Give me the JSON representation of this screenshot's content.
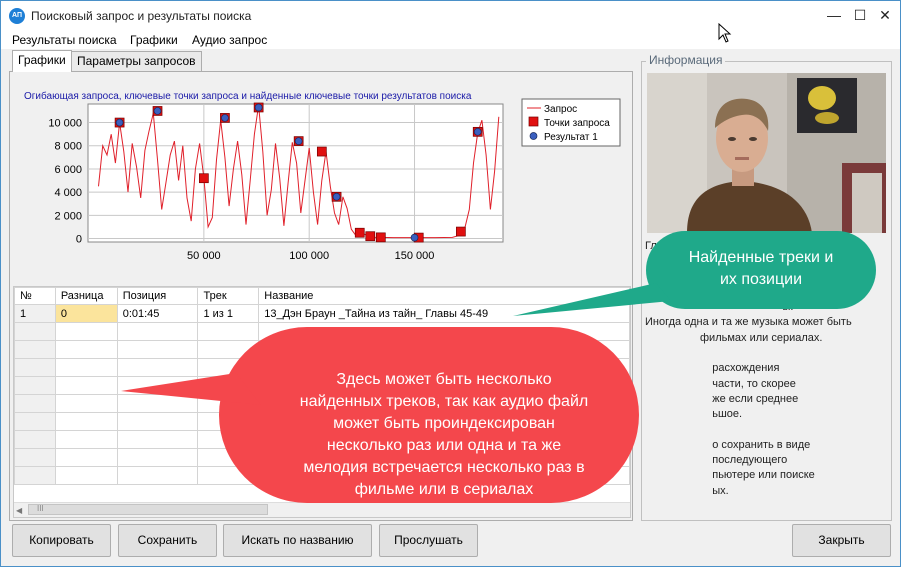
{
  "window": {
    "title": "Поисковый запрос и результаты поиска",
    "app_icon_text": "АП",
    "controls": {
      "minimize": "—",
      "maximize": "☐",
      "close": "✕"
    }
  },
  "menu": [
    "Результаты поиска",
    "Графики",
    "Аудио запрос"
  ],
  "tabs": [
    "Графики",
    "Параметры запросов"
  ],
  "chart_data": {
    "type": "line",
    "title": "Огибающая запроса, ключевые точки запроса и найденные ключевые точки результатов поиска",
    "xlim": [
      -5000,
      192000
    ],
    "ylim": [
      -300,
      11600
    ],
    "x_ticks": [
      50000,
      100000,
      150000
    ],
    "x_tick_labels": [
      "50 000",
      "100 000",
      "150 000"
    ],
    "y_ticks": [
      0,
      2000,
      4000,
      6000,
      8000,
      10000
    ],
    "y_tick_labels": [
      "0",
      "2 000",
      "4 000",
      "6 000",
      "8 000",
      "10 000"
    ],
    "grid": true,
    "legend": "top-right",
    "legend_entries": [
      "Запрос",
      "Точки запроса",
      "Результат 1"
    ],
    "colors": {
      "line": "#e0202a",
      "query_points": "#e01010",
      "result_points": "#3a5fbf"
    },
    "series": [
      {
        "name": "Запрос",
        "x": [
          0,
          2000,
          4000,
          6000,
          8000,
          10000,
          12000,
          14000,
          16000,
          18000,
          20000,
          22000,
          24000,
          26000,
          28000,
          30000,
          32000,
          34000,
          36000,
          38000,
          40000,
          42000,
          44000,
          46000,
          48000,
          50000,
          52000,
          54000,
          56000,
          58000,
          60000,
          62000,
          64000,
          66000,
          68000,
          70000,
          72000,
          74000,
          76000,
          78000,
          80000,
          82000,
          84000,
          86000,
          88000,
          90000,
          92000,
          94000,
          96000,
          98000,
          100000,
          102000,
          104000,
          106000,
          108000,
          110000,
          112000,
          114000,
          116000,
          118000,
          120000,
          122000,
          124000,
          126000,
          128000,
          130000,
          134000,
          140000,
          150000,
          160000,
          168000,
          172000,
          174000,
          176000,
          178000,
          180000,
          182000,
          184000,
          186000,
          188000,
          190000
        ],
        "values": [
          4500,
          8000,
          7200,
          9000,
          6500,
          10000,
          7500,
          4000,
          8200,
          6200,
          3500,
          7600,
          9300,
          10800,
          6800,
          2500,
          4800,
          7200,
          8400,
          5000,
          8000,
          3500,
          1500,
          6000,
          8200,
          5200,
          1000,
          1800,
          6800,
          10200,
          7000,
          2800,
          6000,
          8400,
          5500,
          1200,
          5000,
          9000,
          11500,
          7500,
          2000,
          4200,
          8200,
          5200,
          1100,
          4800,
          8300,
          6500,
          2200,
          5000,
          7800,
          4000,
          1200,
          5000,
          7500,
          4500,
          2200,
          1200,
          3600,
          2600,
          800,
          300,
          600,
          400,
          200,
          100,
          100,
          80,
          80,
          80,
          100,
          300,
          1000,
          2500,
          6500,
          9100,
          10200,
          7200,
          2500,
          5800,
          10500
        ]
      },
      {
        "name": "Точки запроса",
        "x": [
          10000,
          28000,
          50000,
          60000,
          76000,
          95000,
          106000,
          113000,
          124000,
          129000,
          134000,
          152000,
          172000,
          180000
        ],
        "values": [
          10000,
          11000,
          5200,
          10400,
          11300,
          8400,
          7500,
          3600,
          500,
          200,
          100,
          80,
          600,
          9200
        ]
      },
      {
        "name": "Результат 1",
        "x": [
          10000,
          28000,
          60000,
          76000,
          95000,
          113000,
          150000,
          180000
        ],
        "values": [
          10000,
          11000,
          10400,
          11300,
          8400,
          3600,
          80,
          9200
        ]
      }
    ]
  },
  "grid": {
    "columns": [
      "№",
      "Разница",
      "Позиция",
      "Трек",
      "Название"
    ],
    "rows": [
      {
        "num": "1",
        "diff": "0",
        "pos": "0:01:45",
        "track": "1 из 1",
        "name": "13_Дэн Браун _Тайна из тайн_ Главы 45-49"
      }
    ],
    "scroll_grip": "III"
  },
  "info": {
    "label": "Информация",
    "text_lines": [
      "Гл                                              ко",
      "                                                 ки",
      "",
      "спис                                           т",
      "                                             ы.",
      "Иногда одна и та же музыка может быть",
      "                  фильмах или сериалах.",
      "",
      "                      расхождения",
      "                      части, то скорее",
      "                      же если среднее",
      "                      ьшое.",
      "",
      "                      о сохранить в виде",
      "                      последующего",
      "                      пьютере или поиске",
      "                      ых."
    ]
  },
  "buttons": {
    "copy": "Копировать",
    "save": "Сохранить",
    "search_by_name": "Искать по названию",
    "listen": "Прослушать",
    "close": "Закрыть"
  },
  "callouts": {
    "found_tracks": "Найденные треки и их позиции",
    "multiple_tracks": "Здесь может быть несколько найденных треков, так как аудио файл может быть проиндексирован несколько раз или одна и та же мелодия встречается несколько раз в фильме или в сериалах",
    "colors": {
      "green": "#1fa98a",
      "red": "#f4474c"
    }
  }
}
